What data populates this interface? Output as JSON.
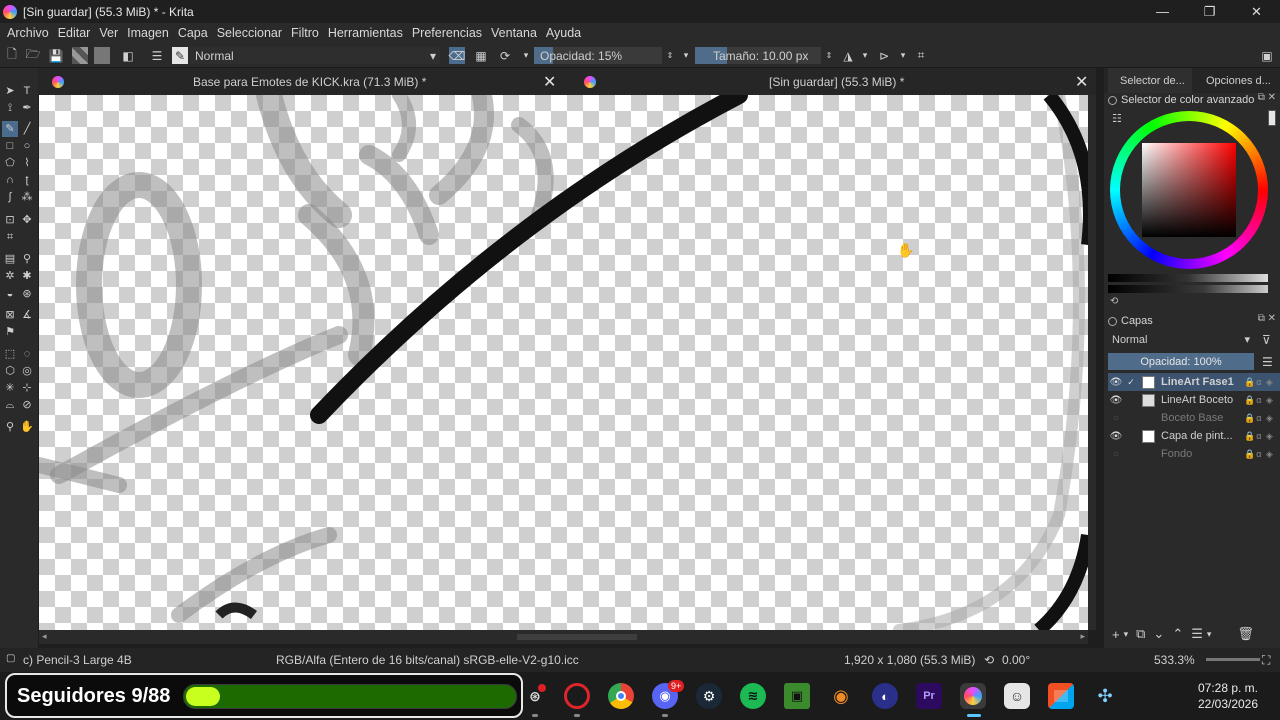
{
  "window": {
    "title": "[Sin guardar]  (55.3 MiB) * - Krita",
    "controls": [
      "—",
      "❐",
      "✕"
    ]
  },
  "menu": [
    "Archivo",
    "Editar",
    "Ver",
    "Imagen",
    "Capa",
    "Seleccionar",
    "Filtro",
    "Herramientas",
    "Preferencias",
    "Ventana",
    "Ayuda"
  ],
  "toolbar": {
    "blend_mode": "Normal",
    "opacity_label": "Opacidad: 15%",
    "opacity_value": 0.15,
    "size_label": "Tamaño: 10.00 px",
    "size_fill": 0.25
  },
  "document_tabs": [
    {
      "title": "Base para Emotes de KICK.kra (71.3 MiB) *",
      "active": false
    },
    {
      "title": "[Sin guardar]  (55.3 MiB) *",
      "active": true
    }
  ],
  "dock": {
    "tabs": [
      "Selector de...",
      "Opciones d..."
    ],
    "color_panel_title": "Selector de color avanzado",
    "layers_panel_title": "Capas",
    "layers_blend": "Normal",
    "layers_opacity": "Opacidad:  100%",
    "layers": [
      {
        "name": "LineArt Fase1",
        "visible": true,
        "selected": true,
        "dim": false
      },
      {
        "name": "LineArt Boceto",
        "visible": true,
        "selected": false,
        "dim": false
      },
      {
        "name": "Boceto Base",
        "visible": false,
        "selected": false,
        "dim": true
      },
      {
        "name": "Capa de pint...",
        "visible": true,
        "selected": false,
        "dim": false
      },
      {
        "name": "Fondo",
        "visible": false,
        "selected": false,
        "dim": true
      }
    ]
  },
  "status": {
    "brush": "c) Pencil-3 Large 4B",
    "color_space": "RGB/Alfa (Entero de 16 bits/canal)  sRGB-elle-V2-g10.icc",
    "dimensions": "1,920 x 1,080 (55.3 MiB)",
    "rotation": "0.00°",
    "zoom": "533.3%"
  },
  "overlay": {
    "followers_label": "Seguidores 9/88",
    "followers_current": 9,
    "followers_goal": 88
  },
  "taskbar": {
    "apps": [
      "wireless-icon",
      "opera-icon",
      "chrome-icon",
      "discord-icon",
      "steam-icon",
      "spotify-icon",
      "minecraft-icon",
      "blender-icon",
      "cinema4d-icon",
      "premiere-icon",
      "krita-icon",
      "twitch-icon",
      "store-icon",
      "tool-icon"
    ],
    "discord_badge": "9+",
    "premiere_label": "Pr",
    "time": "07:28 p. m.",
    "date": "22/03/2026"
  },
  "colors": {
    "accent": "#4f6c8a",
    "progress_track": "#1d6b00",
    "progress_fill": "#c8ff1e"
  }
}
